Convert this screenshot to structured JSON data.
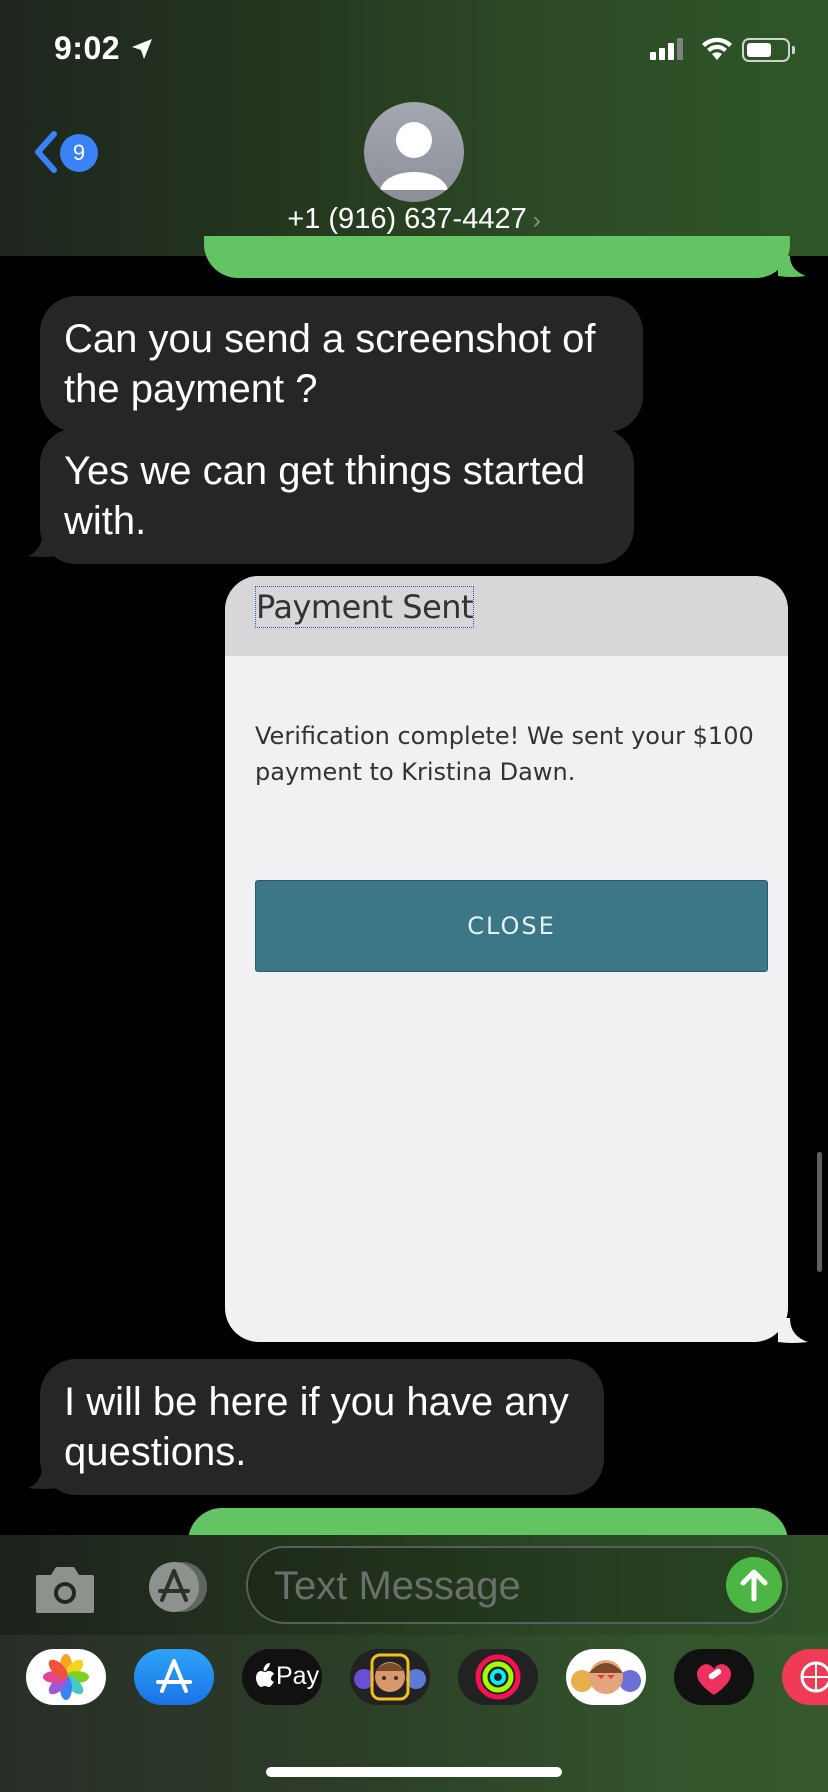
{
  "status_bar": {
    "time": "9:02"
  },
  "header": {
    "back_count": "9",
    "contact_name": "+1 (916) 637-4427",
    "contact_chevron": "›"
  },
  "messages": {
    "received_1": "Can you send a  screenshot of the payment ?",
    "received_2": "Yes we can get things started with.",
    "received_3": "I will be here if you have any questions."
  },
  "screenshot": {
    "title": "Payment Sent",
    "body": "Verification complete! We sent your $100 payment to Kristina Dawn.",
    "button_label": "CLOSE",
    "accent_color": "#3b7787"
  },
  "compose": {
    "placeholder": "Text Message"
  },
  "app_drawer": {
    "items": [
      "photos-icon",
      "app-store-icon",
      "apple-pay-icon",
      "memoji-stickers-icon",
      "activity-icon",
      "animoji-icon",
      "heart-stickers-icon",
      "globe-app-icon"
    ],
    "apple_pay_label": "Pay"
  },
  "colors": {
    "sent_bubble": "#62c462",
    "received_bubble": "#262628",
    "ios_blue": "#3a82f7"
  }
}
